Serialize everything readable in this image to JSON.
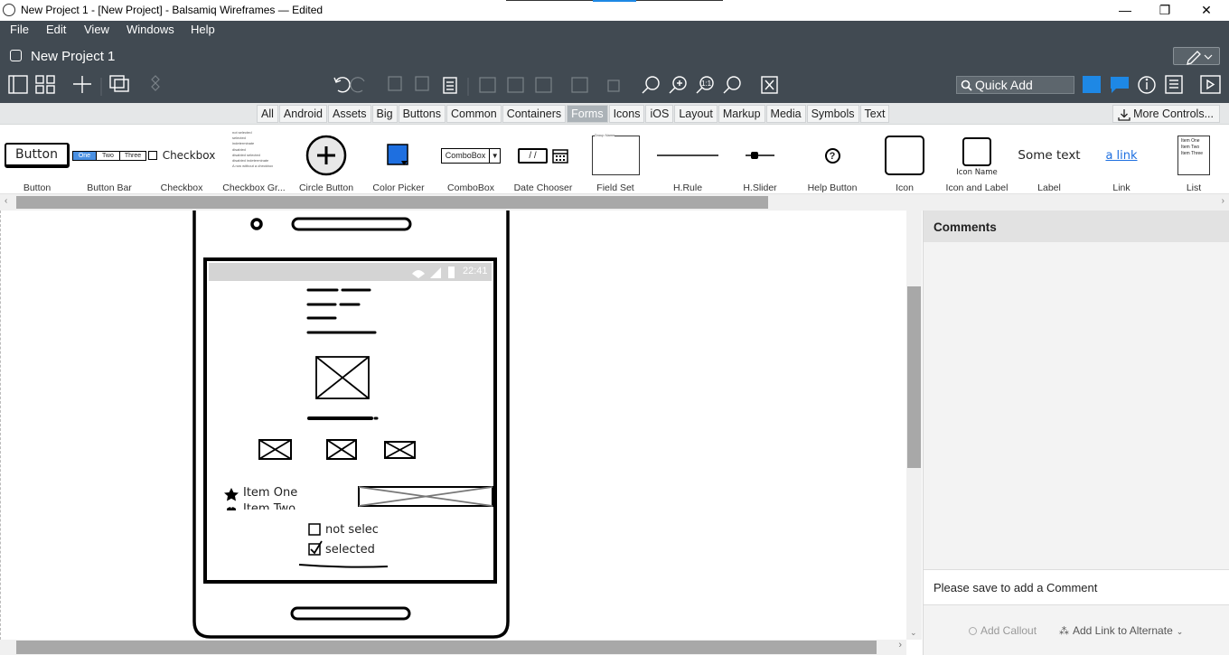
{
  "window": {
    "title": "New Project 1 - [New Project] - Balsamiq Wireframes — Edited",
    "minimize": "—",
    "restore": "❐",
    "close": "✕"
  },
  "menu": [
    "File",
    "Edit",
    "View",
    "Windows",
    "Help"
  ],
  "project": {
    "name": "New Project 1"
  },
  "quick_add": {
    "placeholder": "Quick Add"
  },
  "tabs": [
    "All",
    "Android",
    "Assets",
    "Big",
    "Buttons",
    "Common",
    "Containers",
    "Forms",
    "Icons",
    "iOS",
    "Layout",
    "Markup",
    "Media",
    "Symbols",
    "Text"
  ],
  "selected_tab": "Forms",
  "more_controls": "More Controls...",
  "library": {
    "items": [
      {
        "label": "Button",
        "preview_text": "Button"
      },
      {
        "label": "Button Bar",
        "preview_items": [
          "One",
          "Two",
          "Three"
        ]
      },
      {
        "label": "Checkbox",
        "preview_text": "Checkbox"
      },
      {
        "label": "Checkbox Gr...",
        "preview_items": [
          "not selected",
          "selected",
          "indeterminate",
          "disabled",
          "disabled selected",
          "disabled indeterminate",
          "A row without a checkbox"
        ]
      },
      {
        "label": "Circle Button"
      },
      {
        "label": "Color Picker"
      },
      {
        "label": "ComboBox",
        "preview_text": "ComboBox"
      },
      {
        "label": "Date Chooser",
        "preview_text": "/ /"
      },
      {
        "label": "Field Set",
        "preview_text": "Group Name"
      },
      {
        "label": "H.Rule"
      },
      {
        "label": "H.Slider"
      },
      {
        "label": "Help Button",
        "preview_text": "?"
      },
      {
        "label": "Icon"
      },
      {
        "label": "Icon and Label",
        "preview_text": "Icon Name"
      },
      {
        "label": "Label",
        "preview_text": "Some text"
      },
      {
        "label": "Link",
        "preview_text": "a link"
      },
      {
        "label": "List",
        "preview_items": [
          "Item One",
          "Item Two",
          "Item Three"
        ]
      }
    ]
  },
  "mockup": {
    "status_time": "22:41",
    "list_items": [
      "Item One",
      "Item Two"
    ],
    "checkboxes": [
      {
        "label": "not selec",
        "checked": false
      },
      {
        "label": "selected",
        "checked": true
      }
    ]
  },
  "comments": {
    "title": "Comments",
    "save_prompt": "Please save to add a Comment",
    "add_callout": "Add Callout",
    "add_link": "Add Link to Alternate"
  },
  "colors": {
    "chrome_dark": "#414a52",
    "accent_blue": "#1e88e5",
    "selected_tab": "#abb2b7"
  }
}
